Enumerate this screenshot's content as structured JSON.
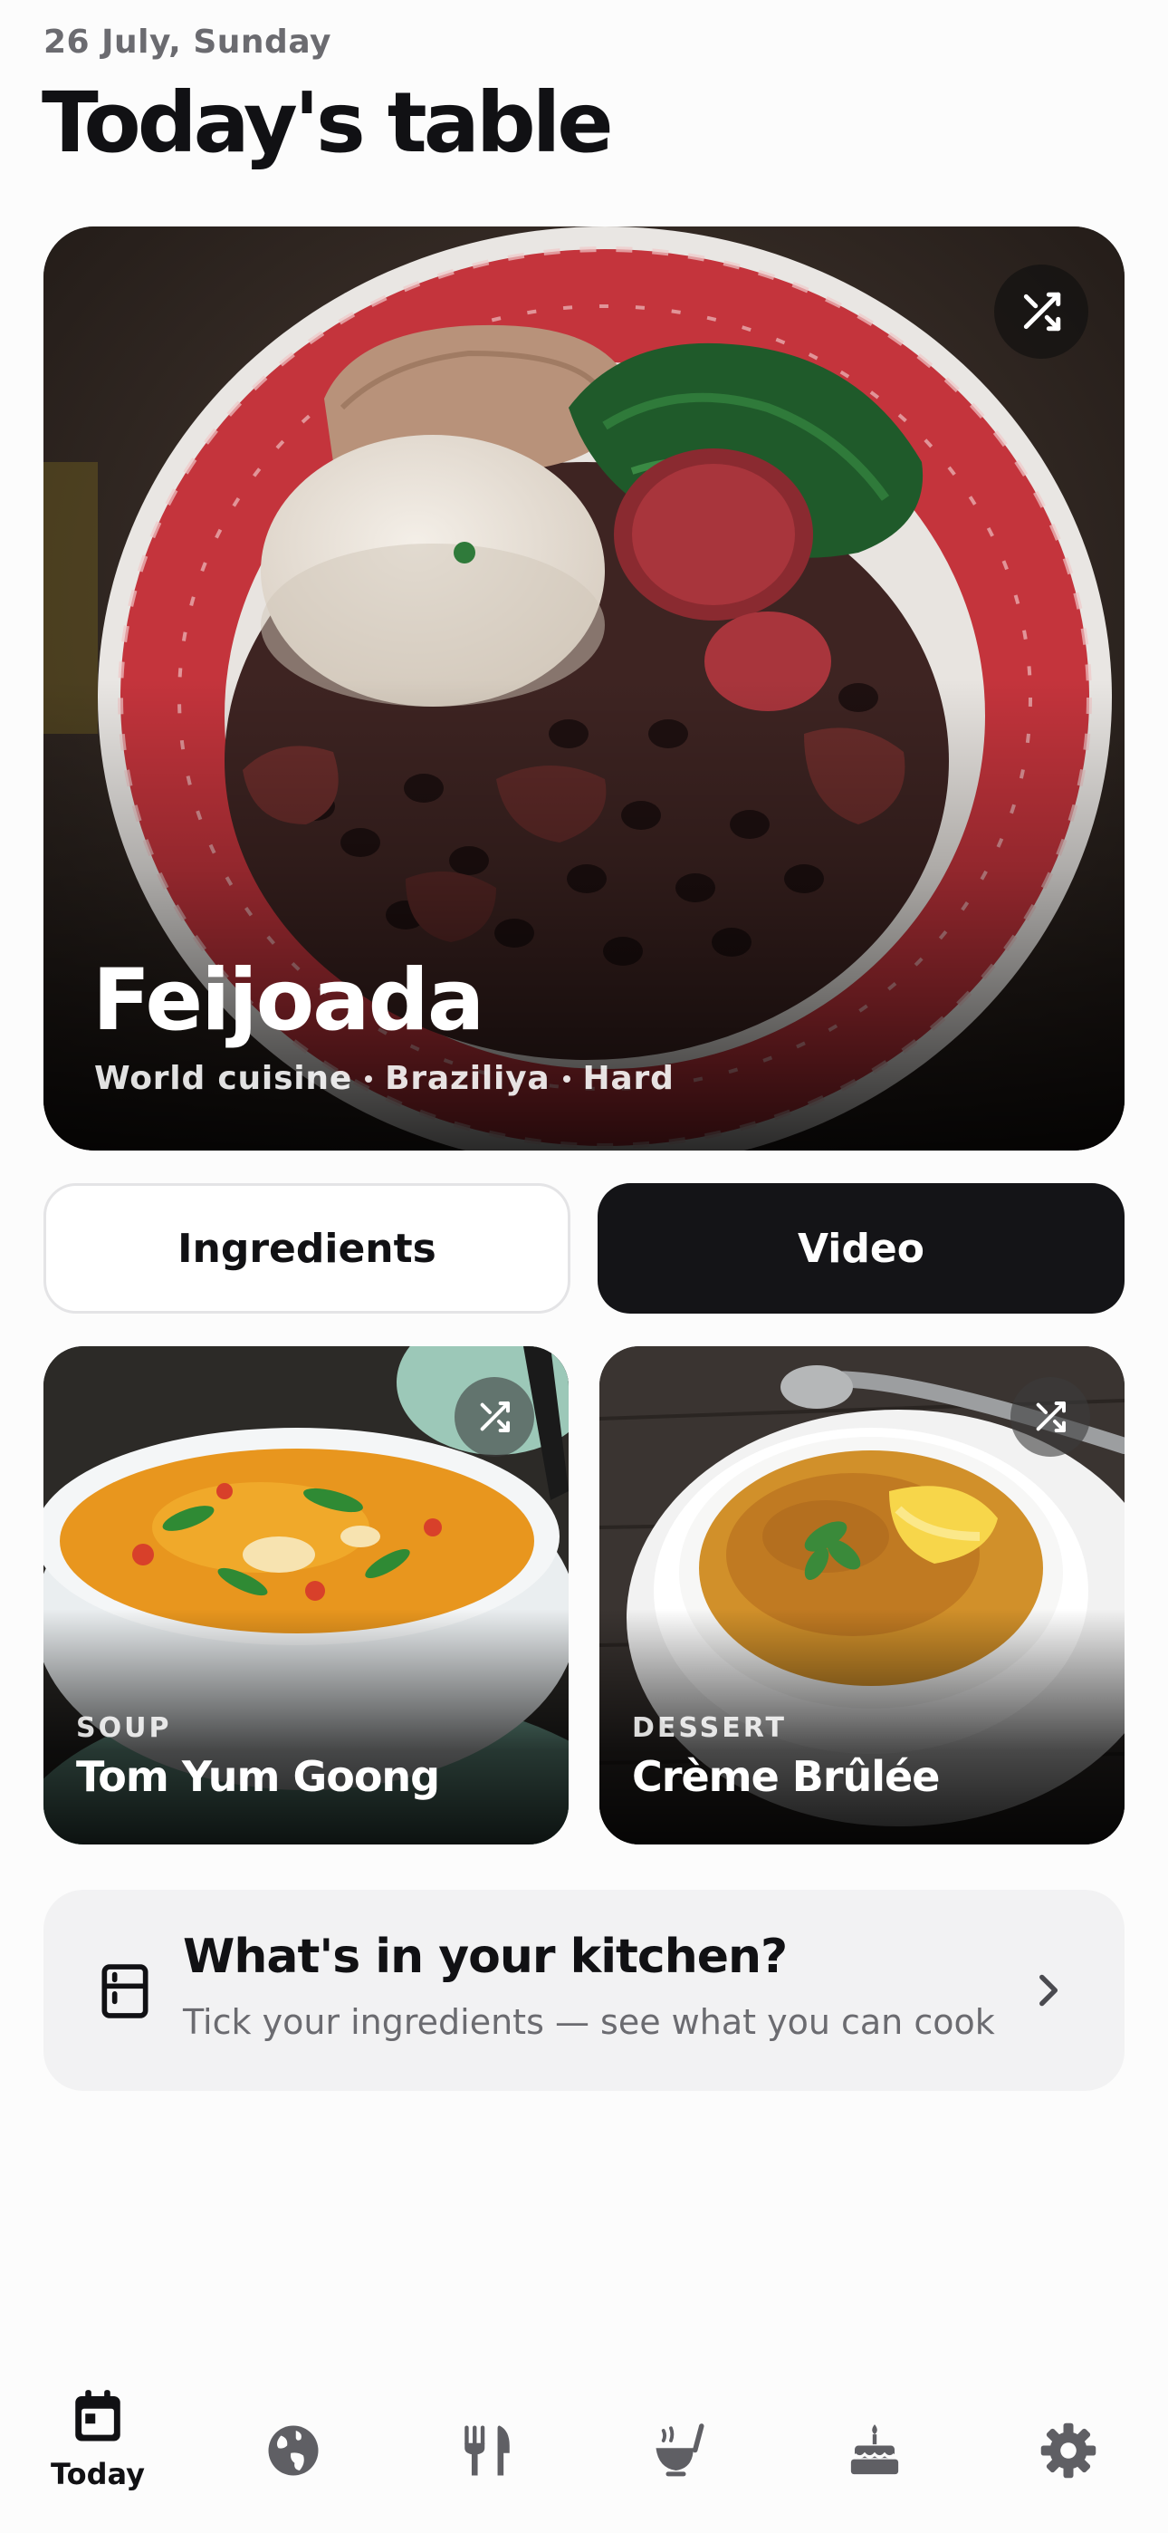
{
  "header": {
    "date": "26 July, Sunday",
    "title": "Today's table"
  },
  "hero": {
    "title": "Feijoada",
    "meta": [
      "World cuisine",
      "Braziliya",
      "Hard"
    ],
    "shuffle_icon": "shuffle-icon"
  },
  "actions": {
    "ingredients_label": "Ingredients",
    "video_label": "Video"
  },
  "cards": [
    {
      "kicker": "SOUP",
      "title": "Tom Yum Goong",
      "shuffle_icon": "shuffle-icon"
    },
    {
      "kicker": "DESSERT",
      "title": "Crème Brûlée",
      "shuffle_icon": "shuffle-icon"
    }
  ],
  "kitchen": {
    "title": "What's in your kitchen?",
    "subtitle": "Tick your ingredients — see what you can cook",
    "icon": "fridge-icon",
    "chevron": "chevron-right-icon"
  },
  "tabbar": {
    "items": [
      {
        "icon": "calendar-icon",
        "label": "Today",
        "active": true
      },
      {
        "icon": "globe-icon",
        "active": false
      },
      {
        "icon": "fork-knife-icon",
        "active": false
      },
      {
        "icon": "ladle-pot-icon",
        "active": false
      },
      {
        "icon": "cake-icon",
        "active": false
      },
      {
        "icon": "gear-icon",
        "active": false
      }
    ]
  },
  "colors": {
    "background": "#fcfcfc",
    "text": "#111114",
    "muted": "#6b6b70",
    "dark_button": "#141417",
    "banner": "#f2f2f3"
  }
}
